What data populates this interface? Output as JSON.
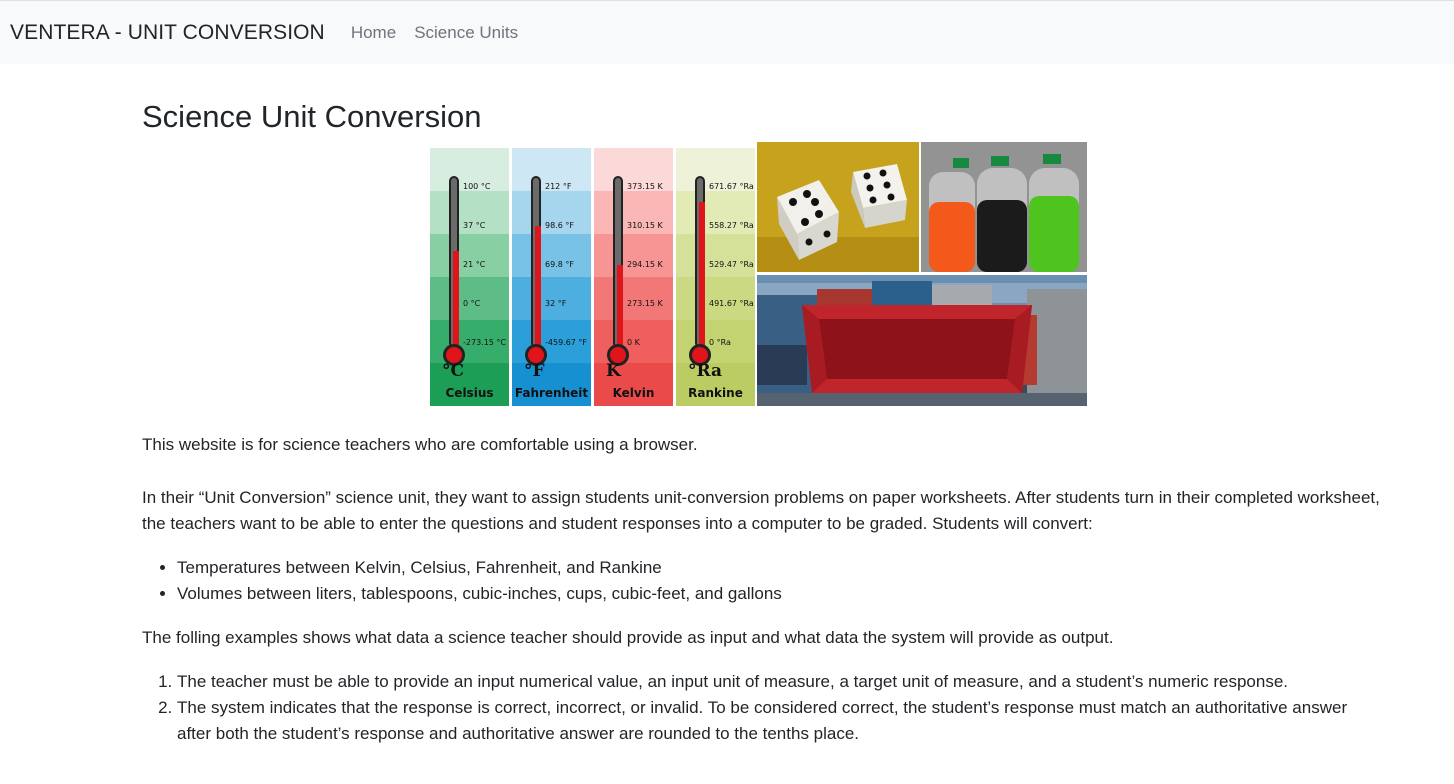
{
  "navbar": {
    "brand": "VENTERA - UNIT CONVERSION",
    "links": [
      "Home",
      "Science Units"
    ]
  },
  "main": {
    "title": "Science Unit Conversion"
  },
  "thermometers": [
    {
      "symbol": "°C",
      "name": "Celsius",
      "ticks": [
        "100 °C",
        "37 °C",
        "21 °C",
        "0 °C",
        "-273.15 °C"
      ],
      "level": 0.55
    },
    {
      "symbol": "°F",
      "name": "Fahrenheit",
      "ticks": [
        "212 °F",
        "98.6 °F",
        "69.8 °F",
        "32 °F",
        "-459.67 °F"
      ],
      "level": 0.7
    },
    {
      "symbol": "K",
      "name": "Kelvin",
      "ticks": [
        "373.15 K",
        "310.15 K",
        "294.15 K",
        "273.15 K",
        "0 K"
      ],
      "level": 0.47
    },
    {
      "symbol": "°Ra",
      "name": "Rankine",
      "ticks": [
        "671.67 °Ra",
        "558.27 °Ra",
        "529.47 °Ra",
        "491.67 °Ra",
        "0 °Ra"
      ],
      "level": 0.84
    }
  ],
  "colors": {
    "celsius": [
      "#d7ede0",
      "#b4e0c5",
      "#88cfa4",
      "#5ebd86",
      "#36ad6b",
      "#1d9e57"
    ],
    "fahrenheit": [
      "#cde8f4",
      "#a6d6ee",
      "#78c2e7",
      "#4dafe0",
      "#2b9fd9",
      "#1790d2"
    ],
    "kelvin": [
      "#fcd9d9",
      "#fab7b6",
      "#f69594",
      "#f27877",
      "#ee5f5e",
      "#ea4b4a"
    ],
    "rankine": [
      "#eef2d8",
      "#e2eab6",
      "#d5e198",
      "#cbd982",
      "#c3d372",
      "#bccc64"
    ],
    "mercury": "#e0141b"
  },
  "content": {
    "intro": "This website is for science teachers who are comfortable using a browser.",
    "description": "In their “Unit Conversion” science unit, they want to assign students unit-conversion problems on paper worksheets. After students turn in their completed worksheet, the teachers want to be able to enter the questions and student responses into a computer to be graded. Students will convert:",
    "bullets": [
      "Temperatures between Kelvin, Celsius, Fahrenheit, and Rankine",
      "Volumes between liters, tablespoons, cubic-inches, cups, cubic-feet, and gallons"
    ],
    "examples_intro": "The folling examples shows what data a science teacher should provide as input and what data the system will provide as output.",
    "steps": [
      "The teacher must be able to provide an input numerical value, an input unit of measure, a target unit of measure, and a student’s numeric response.",
      "The system indicates that the response is correct, incorrect, or invalid. To be considered correct, the student’s response must match an authoritative answer after both the student’s response and authoritative answer are rounded to the tenths place."
    ]
  }
}
